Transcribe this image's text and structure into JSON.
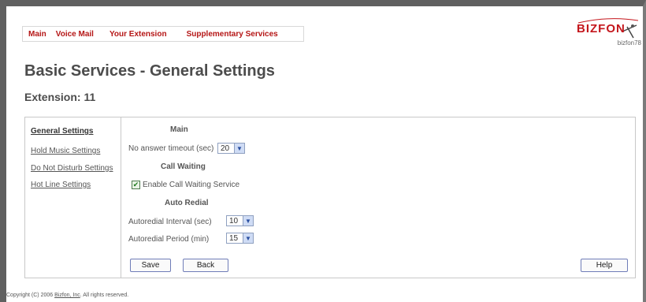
{
  "nav": {
    "items": [
      "Main",
      "Voice Mail",
      "Your Extension",
      "Supplementary Services"
    ]
  },
  "logo": {
    "brand": "BIZFON",
    "host": "bizfon78"
  },
  "page": {
    "title": "Basic Services - General Settings",
    "extension": "Extension: 11"
  },
  "sidebar": {
    "items": [
      {
        "label": "General Settings",
        "active": true
      },
      {
        "label": "Hold Music Settings",
        "active": false
      },
      {
        "label": "Do Not Disturb Settings",
        "active": false
      },
      {
        "label": "Hot Line Settings",
        "active": false
      }
    ]
  },
  "form": {
    "main_section": "Main",
    "no_answer_label": "No answer timeout (sec)",
    "no_answer_value": "20",
    "call_waiting_section": "Call Waiting",
    "call_waiting_label": "Enable Call Waiting Service",
    "call_waiting_checked": true,
    "auto_redial_section": "Auto Redial",
    "interval_label": "Autoredial Interval (sec)",
    "interval_value": "10",
    "period_label": "Autoredial Period (min)",
    "period_value": "15"
  },
  "buttons": {
    "save": "Save",
    "back": "Back",
    "help": "Help"
  },
  "footer": {
    "prefix": "Copyright (C) 2006",
    "company": "Bizfon, Inc",
    "suffix": ". All rights reserved."
  },
  "colors": {
    "nav_text": "#b51616",
    "brand": "#c4161c",
    "frame": "#606060"
  }
}
